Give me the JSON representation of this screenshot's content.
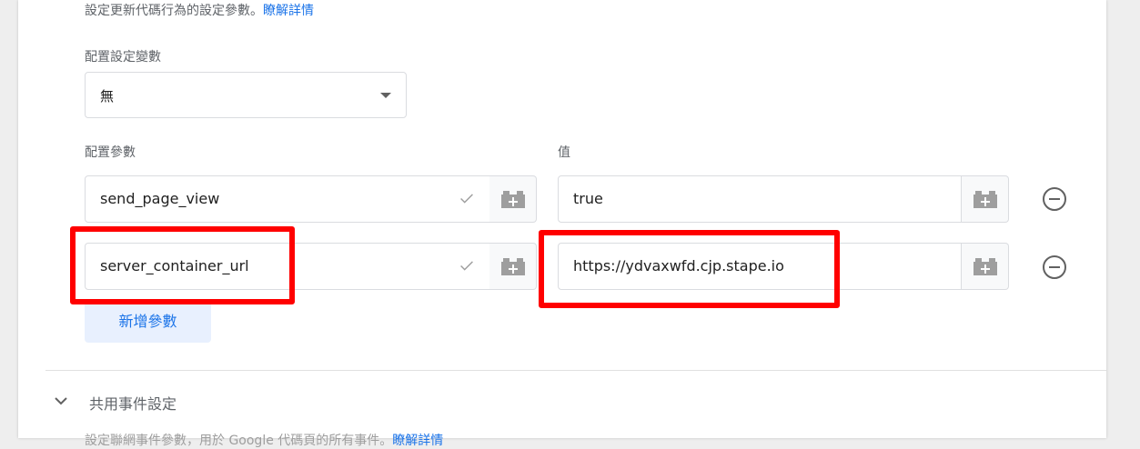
{
  "config": {
    "description": "設定更新代碼行為的設定參數。",
    "learn_more": "瞭解詳情",
    "config_var_label": "配置設定變數",
    "config_var_value": "無",
    "params_label": "配置參數",
    "value_label": "值",
    "rows": [
      {
        "param": "send_page_view",
        "value": "true"
      },
      {
        "param": "server_container_url",
        "value": "https://ydvaxwfd.cjp.stape.io"
      }
    ],
    "add_param_label": "新增參數"
  },
  "shared_section": {
    "title": "共用事件設定",
    "description_cut": "設定聯網事件參數，用於 Google 代碼頁的所有事件。",
    "learn_more": "瞭解詳情"
  },
  "colors": {
    "accent": "#1a73e8",
    "highlight": "#ff0000"
  }
}
